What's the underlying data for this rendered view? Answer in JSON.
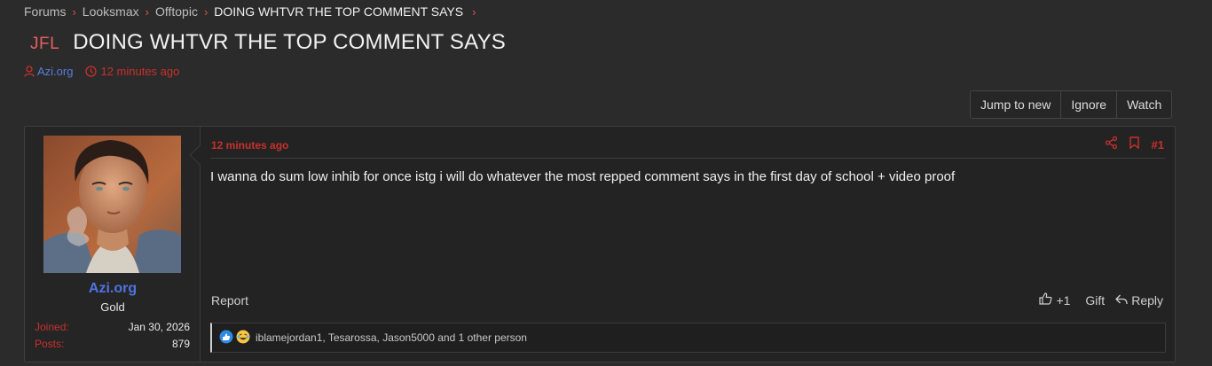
{
  "breadcrumb": [
    {
      "label": "Forums"
    },
    {
      "label": "Looksmax"
    },
    {
      "label": "Offtopic"
    },
    {
      "label": "DOING WHTVR THE TOP COMMENT SAYS"
    }
  ],
  "thread": {
    "prefix": "JFL",
    "title": "DOING WHTVR THE TOP COMMENT SAYS",
    "author": "Azi.org",
    "time": "12 minutes ago"
  },
  "thread_actions": {
    "jump": "Jump to new",
    "ignore": "Ignore",
    "watch": "Watch"
  },
  "post": {
    "time": "12 minutes ago",
    "number": "#1",
    "body": "I wanna do sum low inhib for once istg i will do whatever the most repped comment says in the first day of school + video proof",
    "report": "Report",
    "like_count": "+1",
    "gift": "Gift",
    "reply": "Reply",
    "reactions_text": "iblamejordan1, Tesarossa, Jason5000 and 1 other person"
  },
  "user": {
    "name": "Azi.org",
    "rank": "Gold",
    "joined_label": "Joined:",
    "joined_value": "Jan 30, 2026",
    "posts_label": "Posts:",
    "posts_value": "879"
  },
  "colors": {
    "accent_red": "#c9302c",
    "username_blue": "#4f74e3",
    "background": "#2b2b2b"
  },
  "icons": [
    "chevron-right-icon",
    "user-icon",
    "clock-icon",
    "share-icon",
    "bookmark-icon",
    "thumbs-up-icon",
    "reply-icon",
    "like-reaction-icon",
    "laugh-reaction-icon"
  ]
}
